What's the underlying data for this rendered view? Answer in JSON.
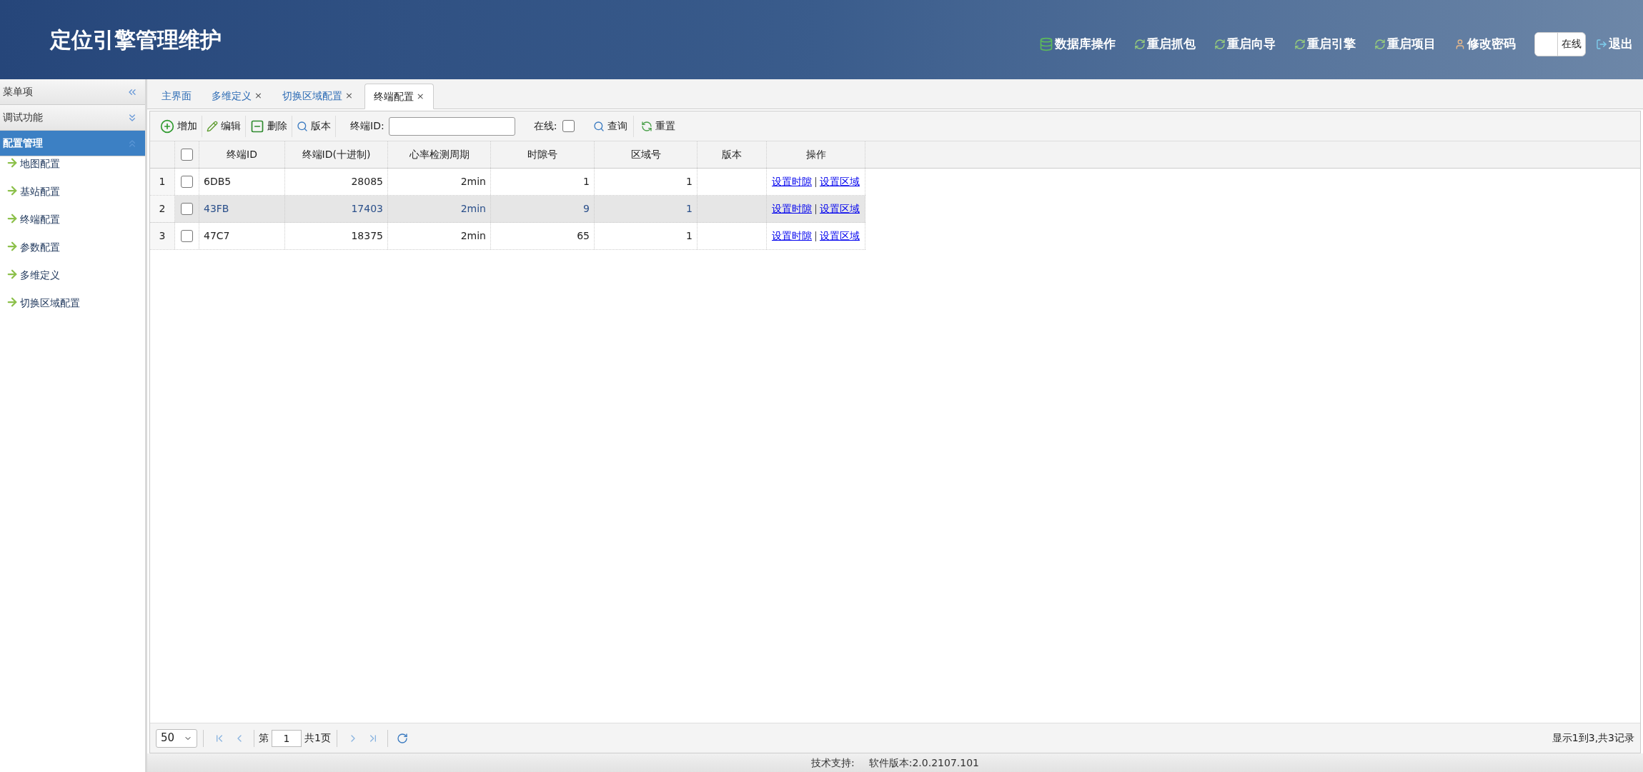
{
  "header": {
    "title": "定位引擎管理维护",
    "actions": [
      {
        "kind": "database",
        "label": "数据库操作"
      },
      {
        "kind": "restart",
        "label": "重启抓包"
      },
      {
        "kind": "restart",
        "label": "重启向导"
      },
      {
        "kind": "restart",
        "label": "重启引擎"
      },
      {
        "kind": "restart",
        "label": "重启项目"
      },
      {
        "kind": "user",
        "label": "修改密码"
      }
    ],
    "switch": {
      "label": "在线",
      "on": false
    },
    "logout": "退出"
  },
  "sidebar": {
    "title": "菜单项",
    "sections": [
      {
        "label": "调试功能",
        "expanded": false
      },
      {
        "label": "配置管理",
        "expanded": true,
        "items": [
          "地图配置",
          "基站配置",
          "终端配置",
          "参数配置",
          "多维定义",
          "切换区域配置"
        ]
      }
    ]
  },
  "tabs": [
    {
      "label": "主界面",
      "selected": false
    },
    {
      "label": "多维定义",
      "close": "×",
      "selected": false
    },
    {
      "label": "切换区域配置",
      "close": "×",
      "selected": false
    },
    {
      "label": "终端配置",
      "close": "×",
      "selected": true
    }
  ],
  "toolbar": {
    "buttons": [
      {
        "kind": "add",
        "label": "增加"
      },
      {
        "kind": "edit",
        "label": "编辑"
      },
      {
        "kind": "delete",
        "label": "删除"
      },
      {
        "kind": "search",
        "label": "版本"
      }
    ],
    "id_label": "终端ID:",
    "online_label": "在线:",
    "online_checked": false,
    "query": "查询",
    "reset": "重置"
  },
  "table": {
    "header_checked": false,
    "columns": [
      "终端ID",
      "终端ID(十进制)",
      "心率检测周期",
      "时隙号",
      "区域号",
      "版本",
      "操作"
    ],
    "rows": [
      {
        "index": "1",
        "checked": false,
        "selected": false,
        "cells": [
          "6DB5",
          "28085",
          "2min",
          "1",
          "1"
        ],
        "actions": [
          "设置时隙",
          "设置区域"
        ]
      },
      {
        "index": "2",
        "checked": false,
        "selected": true,
        "cells": [
          "43FB",
          "17403",
          "2min",
          "9",
          "1"
        ],
        "actions": [
          "设置时隙",
          "设置区域"
        ]
      },
      {
        "index": "3",
        "checked": false,
        "selected": false,
        "cells": [
          "47C7",
          "18375",
          "2min",
          "65",
          "1"
        ],
        "actions": [
          "设置时隙",
          "设置区域"
        ]
      }
    ]
  },
  "pager": {
    "page_size": "50",
    "page_prefix": "第",
    "page": "1",
    "page_suffix": "共1页",
    "info": "显示1到3,共3记录"
  },
  "footer": {
    "support": "技术支持:",
    "version": "软件版本:2.0.2107.101"
  }
}
